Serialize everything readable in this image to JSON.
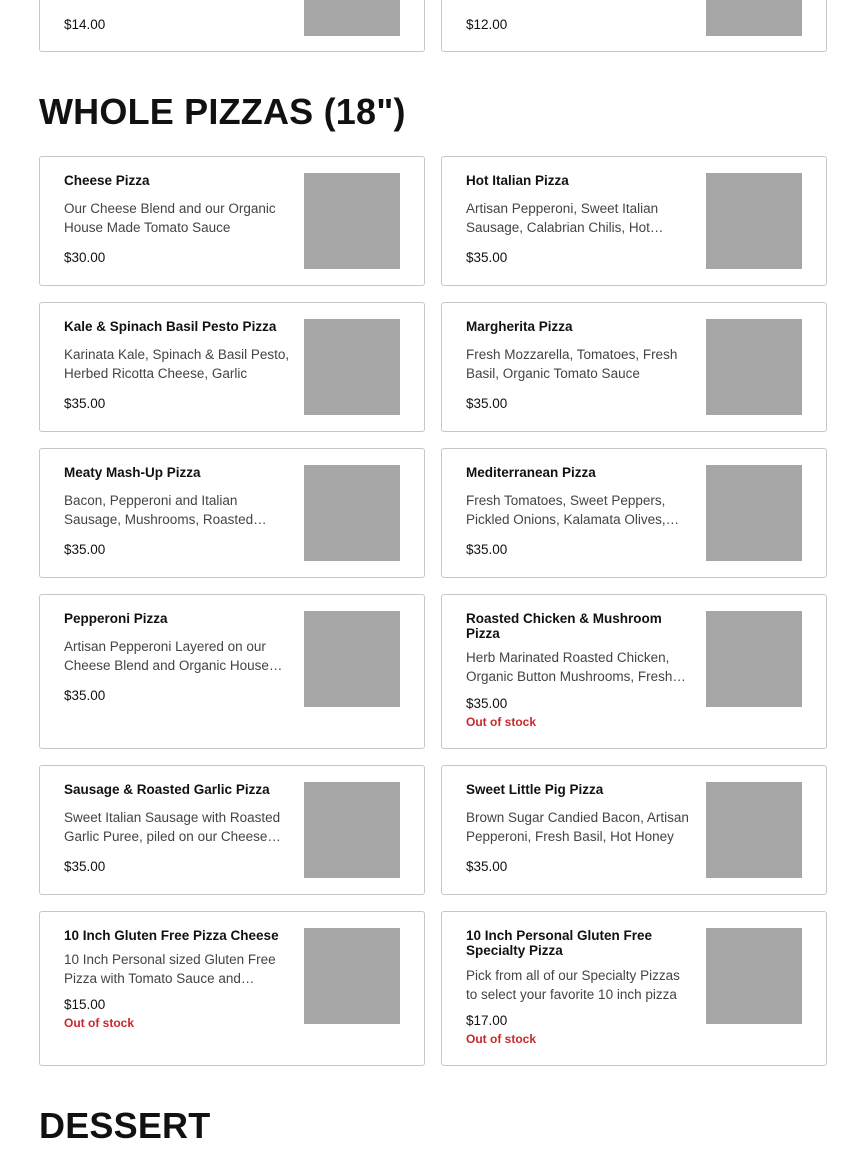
{
  "colors": {
    "out_of_stock": "#c8282d",
    "card_border": "#c7c7c7",
    "thumbnail_placeholder": "#a6a6a6"
  },
  "top_partial": [
    {
      "price": "$14.00"
    },
    {
      "price": "$12.00"
    }
  ],
  "whole_pizzas": {
    "title": "WHOLE PIZZAS (18\")",
    "items": [
      {
        "name": "Cheese Pizza",
        "description": "Our Cheese Blend and our Organic House Made Tomato Sauce",
        "price": "$30.00",
        "status": ""
      },
      {
        "name": "Hot Italian Pizza",
        "description": "Artisan Pepperoni, Sweet Italian Sausage, Calabrian Chilis, Hot Honey",
        "price": "$35.00",
        "status": ""
      },
      {
        "name": "Kale & Spinach Basil Pesto Pizza",
        "description": "Karinata Kale, Spinach & Basil Pesto, Herbed Ricotta Cheese, Garlic",
        "price": "$35.00",
        "status": ""
      },
      {
        "name": "Margherita Pizza",
        "description": "Fresh Mozzarella, Tomatoes, Fresh Basil, Organic Tomato Sauce",
        "price": "$35.00",
        "status": ""
      },
      {
        "name": "Meaty Mash-Up Pizza",
        "description": "Bacon, Pepperoni and Italian Sausage, Mushrooms, Roasted Garlic",
        "price": "$35.00",
        "status": ""
      },
      {
        "name": "Mediterranean Pizza",
        "description": "Fresh Tomatoes, Sweet Peppers, Pickled Onions, Kalamata Olives, Feta",
        "price": "$35.00",
        "status": ""
      },
      {
        "name": "Pepperoni Pizza",
        "description": "Artisan Pepperoni Layered on our Cheese Blend and Organic House Made Sauce",
        "price": "$35.00",
        "status": ""
      },
      {
        "name": "Roasted Chicken & Mushroom Pizza",
        "description": "Herb Marinated Roasted Chicken, Organic Button Mushrooms, Fresh Herbs",
        "price": "$35.00",
        "status": "Out of stock"
      },
      {
        "name": "Sausage & Roasted Garlic Pizza",
        "description": "Sweet Italian Sausage with Roasted Garlic Puree, piled on our Cheese Blend",
        "price": "$35.00",
        "status": ""
      },
      {
        "name": "Sweet Little Pig Pizza",
        "description": "Brown Sugar Candied Bacon, Artisan Pepperoni, Fresh Basil, Hot Honey",
        "price": "$35.00",
        "status": ""
      },
      {
        "name": "10 Inch Gluten Free Pizza Cheese",
        "description": "10 Inch Personal sized Gluten Free Pizza with Tomato Sauce and Cheese Blend",
        "price": "$15.00",
        "status": "Out of stock"
      },
      {
        "name": "10 Inch Personal Gluten Free Specialty Pizza",
        "description": "Pick from all of our Specialty Pizzas to select your favorite 10 inch pizza",
        "price": "$17.00",
        "status": "Out of stock"
      }
    ]
  },
  "dessert": {
    "title": "DESSERT"
  }
}
